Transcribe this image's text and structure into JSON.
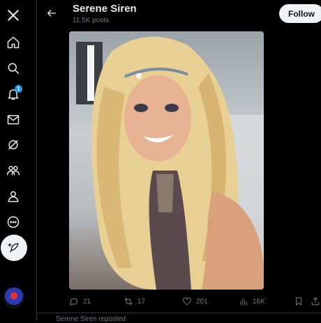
{
  "nav": {
    "items": [
      {
        "icon": "x-logo-icon"
      },
      {
        "icon": "home-icon"
      },
      {
        "icon": "search-icon"
      },
      {
        "icon": "bell-icon",
        "badge": "1"
      },
      {
        "icon": "mail-icon"
      },
      {
        "icon": "grok-icon"
      },
      {
        "icon": "communities-icon"
      },
      {
        "icon": "profile-icon"
      },
      {
        "icon": "more-icon"
      }
    ],
    "compose_icon": "feather-plus-icon"
  },
  "header": {
    "title": "Serene Siren",
    "posts_count": "11.5K posts",
    "follow_label": "Follow"
  },
  "media": {
    "alt": "Photo of Serene Siren"
  },
  "actions": {
    "replies": "21",
    "reposts": "17",
    "likes": "201",
    "views": "16K"
  },
  "next_post": {
    "text": "Serene Siren reposted"
  },
  "colors": {
    "accent": "#1d9bf0",
    "background": "#000000",
    "muted": "#71767b",
    "button_bg": "#eff3f4"
  }
}
